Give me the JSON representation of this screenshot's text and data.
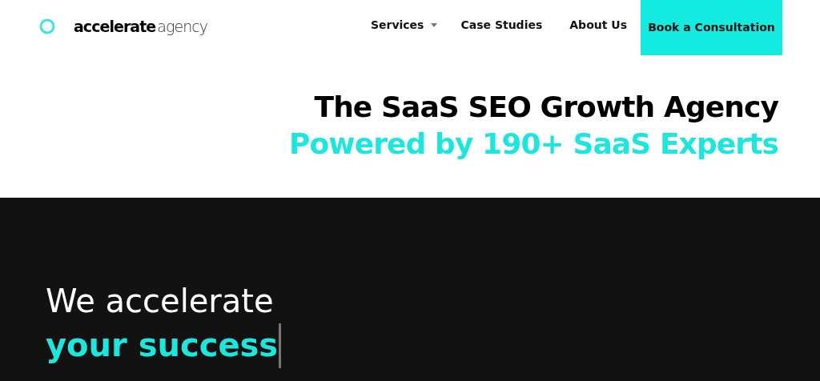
{
  "header": {
    "logo": {
      "name": "accelerate",
      "suffix": "agency"
    },
    "nav": [
      {
        "label": "Services",
        "has_dropdown": true
      },
      {
        "label": "Case Studies",
        "has_dropdown": false
      },
      {
        "label": "About Us",
        "has_dropdown": false
      }
    ],
    "cta": "Book a Consultation"
  },
  "intro": {
    "title": "The SaaS SEO Growth Agency",
    "subtitle": "Powered by 190+ SaaS Experts"
  },
  "hero": {
    "line_1": "We accelerate",
    "line_2": "your success",
    "cursor": true
  }
}
